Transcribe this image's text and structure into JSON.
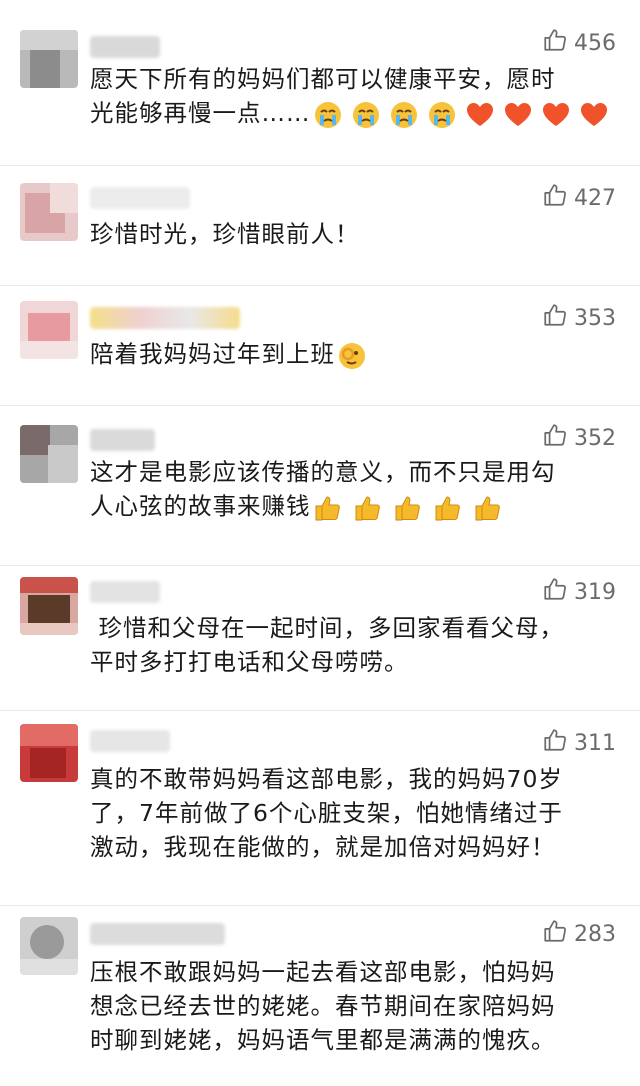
{
  "comments": [
    {
      "likes": "456",
      "lines": [
        "愿天下所有的妈妈们都可以健康平安，愿时",
        "光能够再慢一点……"
      ],
      "emojis": [
        "crying-face",
        "crying-face",
        "crying-face",
        "crying-face",
        "heart",
        "heart",
        "heart",
        "heart"
      ]
    },
    {
      "likes": "427",
      "lines": [
        "珍惜时光，珍惜眼前人！"
      ],
      "emojis": []
    },
    {
      "likes": "353",
      "lines": [
        "陪着我妈妈过年到上班"
      ],
      "emojis": [
        "ok-hand-face"
      ]
    },
    {
      "likes": "352",
      "lines": [
        "这才是电影应该传播的意义，而不只是用勾",
        "人心弦的故事来赚钱"
      ],
      "emojis": [
        "thumbs-up",
        "thumbs-up",
        "thumbs-up",
        "thumbs-up",
        "thumbs-up"
      ]
    },
    {
      "likes": "319",
      "lines": [
        " 珍惜和父母在一起时间，多回家看看父母，",
        "平时多打打电话和父母唠唠。"
      ],
      "emojis": []
    },
    {
      "likes": "311",
      "lines": [
        "真的不敢带妈妈看这部电影，我的妈妈70岁",
        "了，7年前做了6个心脏支架，怕她情绪过于",
        "激动，我现在能做的，就是加倍对妈妈好！"
      ],
      "emojis": []
    },
    {
      "likes": "283",
      "lines": [
        "压根不敢跟妈妈一起去看这部电影，怕妈妈",
        "想念已经去世的姥姥。春节期间在家陪妈妈",
        "时聊到姥姥，妈妈语气里都是满满的愧疚。"
      ],
      "emojis": []
    }
  ],
  "icons": {
    "like": "thumbs-up-outline-icon"
  },
  "colors": {
    "like_text": "#6b6b6b",
    "body_text": "#1a1a1a",
    "divider": "#e9e9e9"
  }
}
